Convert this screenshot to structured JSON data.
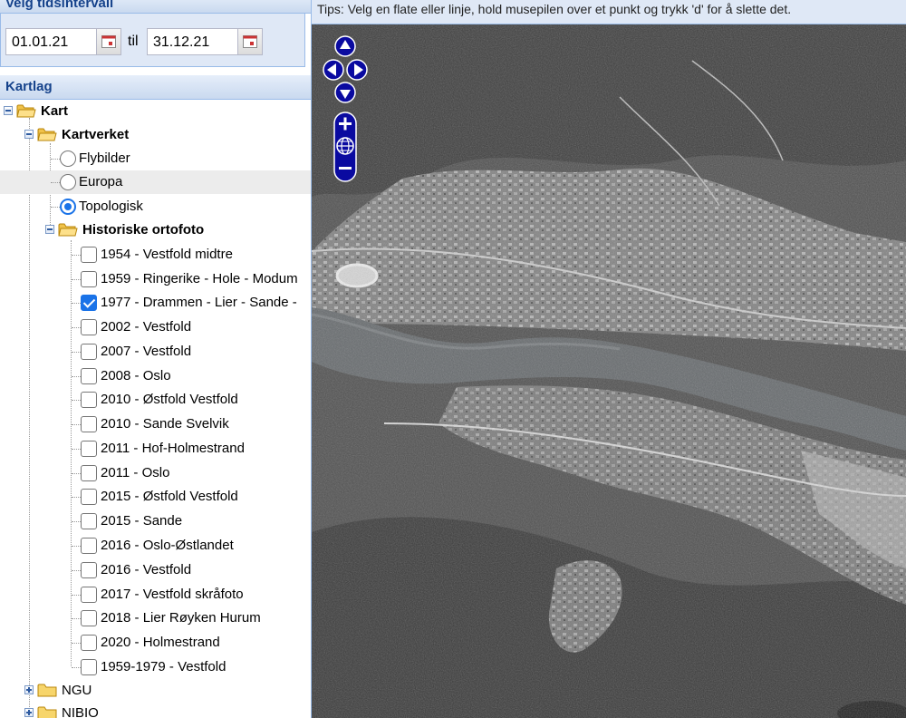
{
  "time_panel": {
    "title": "Velg tidsintervall",
    "from_date": "01.01.21",
    "to_word": "til",
    "to_date": "31.12.21"
  },
  "layers_panel": {
    "title": "Kartlag",
    "root": "Kart",
    "kartverket": "Kartverket",
    "base_layers": [
      {
        "label": "Flybilder",
        "selected": false
      },
      {
        "label": "Europa",
        "selected": false
      },
      {
        "label": "Topologisk",
        "selected": true
      }
    ],
    "historical_group": "Historiske ortofoto",
    "historical_layers": [
      {
        "label": "1954 - Vestfold midtre",
        "checked": false
      },
      {
        "label": "1959 - Ringerike - Hole - Modum",
        "checked": false
      },
      {
        "label": "1977 - Drammen - Lier - Sande -",
        "checked": true
      },
      {
        "label": "2002 - Vestfold",
        "checked": false
      },
      {
        "label": "2007 - Vestfold",
        "checked": false
      },
      {
        "label": "2008 - Oslo",
        "checked": false
      },
      {
        "label": "2010 - Østfold Vestfold",
        "checked": false
      },
      {
        "label": "2010 - Sande Svelvik",
        "checked": false
      },
      {
        "label": "2011 - Hof-Holmestrand",
        "checked": false
      },
      {
        "label": "2011 - Oslo",
        "checked": false
      },
      {
        "label": "2015 - Østfold Vestfold",
        "checked": false
      },
      {
        "label": "2015 - Sande",
        "checked": false
      },
      {
        "label": "2016 - Oslo-Østlandet",
        "checked": false
      },
      {
        "label": "2016 - Vestfold",
        "checked": false
      },
      {
        "label": "2017 - Vestfold skråfoto",
        "checked": false
      },
      {
        "label": "2018 - Lier Røyken Hurum",
        "checked": false
      },
      {
        "label": "2020 - Holmestrand",
        "checked": false
      },
      {
        "label": "1959-1979 - Vestfold",
        "checked": false
      }
    ],
    "other_groups": [
      "NGU",
      "NIBIO"
    ]
  },
  "map": {
    "tip": "Tips: Velg en flate eller linje, hold musepilen over et punkt og trykk 'd' for å slette det.",
    "nav_icons": [
      "pan-up-icon",
      "pan-left-icon",
      "pan-right-icon",
      "pan-down-icon",
      "zoom-in-icon",
      "zoom-world-icon",
      "zoom-out-icon"
    ]
  },
  "colors": {
    "panel_header_text": "#15428b",
    "panel_header_bg": "#dfe8f6",
    "accent": "#1a73e8",
    "nav_control": "#0a0aa0",
    "selected_row": "#ececec"
  }
}
